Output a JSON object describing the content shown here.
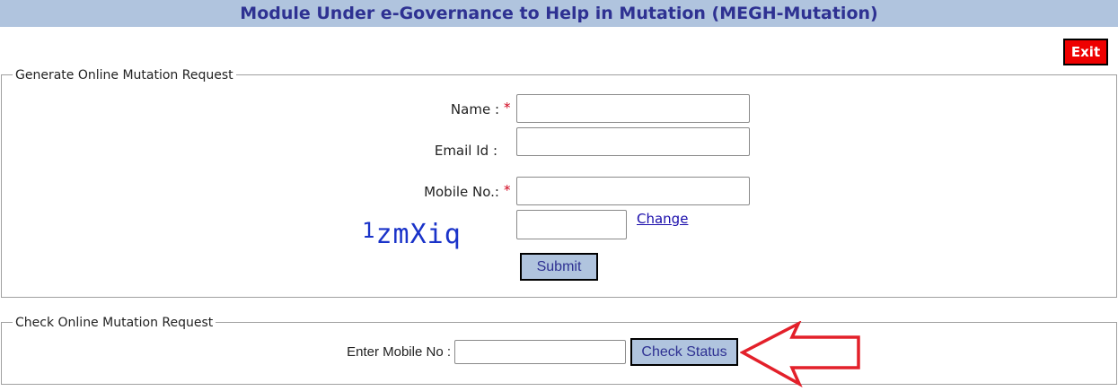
{
  "header": {
    "title": "Module Under e-Governance to Help in Mutation (MEGH-Mutation)"
  },
  "actions": {
    "exit_label": "Exit"
  },
  "generate": {
    "legend": "Generate Online Mutation Request",
    "name_label": "Name :",
    "email_label": "Email Id :",
    "mobile_label": "Mobile No.:",
    "required_mark": "*",
    "name_value": "",
    "email_value": "",
    "mobile_value": "",
    "captcha_first": "1",
    "captcha_rest": "zmXiq",
    "captcha_value": "",
    "change_label": "Change",
    "submit_label": "Submit"
  },
  "check": {
    "legend": "Check Online Mutation Request",
    "mobile_label": "Enter Mobile No :",
    "mobile_value": "",
    "check_label": "Check Status"
  },
  "colors": {
    "header_bg": "#b0c4de",
    "header_text": "#2e3192",
    "exit_bg": "#ee0000",
    "captcha_text": "#1a33c9",
    "arrow_outline": "#e3202a",
    "required": "#d0021b"
  },
  "icons": {
    "annotation": "arrow-left-icon"
  }
}
